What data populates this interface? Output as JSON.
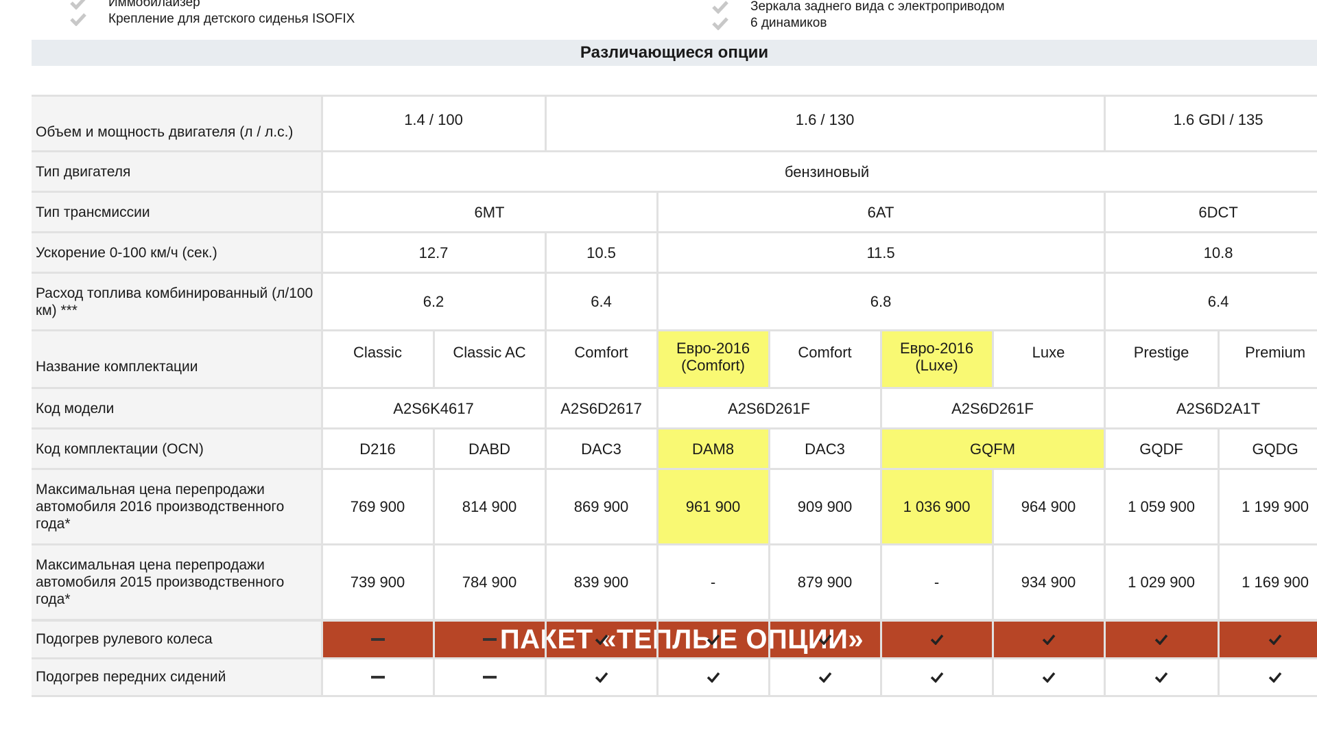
{
  "top_features": {
    "left": [
      "Иммобилайзер",
      "Крепление для детского сиденья ISOFIX"
    ],
    "right": [
      "Зеркала заднего вида с электроприводом",
      "6 динамиков"
    ]
  },
  "section_title": "Различающиеся опции",
  "spec": {
    "engine_label": "Объем и мощность двигателя (л / л.с.)",
    "engine_values": [
      "1.4 / 100",
      "1.6 / 130",
      "1.6 GDI / 135"
    ],
    "engine_type_label": "Тип двигателя",
    "engine_type_value": "бензиновый",
    "transmission_label": "Тип трансмиссии",
    "transmission_values": [
      "6MT",
      "6AT",
      "6DCT"
    ],
    "accel_label": "Ускорение 0-100 км/ч (сек.)",
    "accel_values": [
      "12.7",
      "10.5",
      "11.5",
      "10.8"
    ],
    "fuel_label": "Расход топлива комбинированный (л/100 км) ***",
    "fuel_values": [
      "6.2",
      "6.4",
      "6.8",
      "6.4"
    ],
    "trim_label": "Название комплектации",
    "trims": [
      "Classic",
      "Classic AC",
      "Comfort",
      "Евро-2016 (Comfort)",
      "Comfort",
      "Евро-2016 (Luxe)",
      "Luxe",
      "Prestige",
      "Premium"
    ],
    "model_code_label": "Код модели",
    "model_codes": [
      "A2S6K4617",
      "A2S6D2617",
      "A2S6D261F",
      "A2S6D261F",
      "A2S6D2A1T"
    ],
    "ocn_label": "Код комплектации (OCN)",
    "ocn_codes": [
      "D216",
      "DABD",
      "DAC3",
      "DAM8",
      "DAC3",
      "GQFM",
      "GQDF",
      "GQDG"
    ],
    "price2016_label": "Максимальная цена перепродажи автомобиля 2016 производственного года*",
    "price2016": [
      "769 900",
      "814 900",
      "869 900",
      "961 900",
      "909 900",
      "1 036 900",
      "964 900",
      "1 059 900",
      "1 199 900"
    ],
    "price2015_label": "Максимальная цена перепродажи автомобиля 2015 производственного года*",
    "price2015": [
      "739 900",
      "784 900",
      "839 900",
      "-",
      "879 900",
      "-",
      "934 900",
      "1 029 900",
      "1 169 900"
    ]
  },
  "promo_title": "ПАКЕТ «ТЕПЛЫЕ ОПЦИИ»",
  "warm_options": {
    "rows": [
      {
        "label": "Подогрев рулевого колеса",
        "values": [
          "dash",
          "dash",
          "check",
          "check",
          "check",
          "check",
          "check",
          "check",
          "check"
        ]
      },
      {
        "label": "Подогрев передних сидений",
        "values": [
          "dash",
          "dash",
          "check",
          "check",
          "check",
          "check",
          "check",
          "check",
          "check"
        ]
      }
    ]
  },
  "colors": {
    "highlight": "#f9f973",
    "promo_bg": "#b74526",
    "label_bg": "#f4f4f4",
    "grid": "#e1e1e1"
  }
}
